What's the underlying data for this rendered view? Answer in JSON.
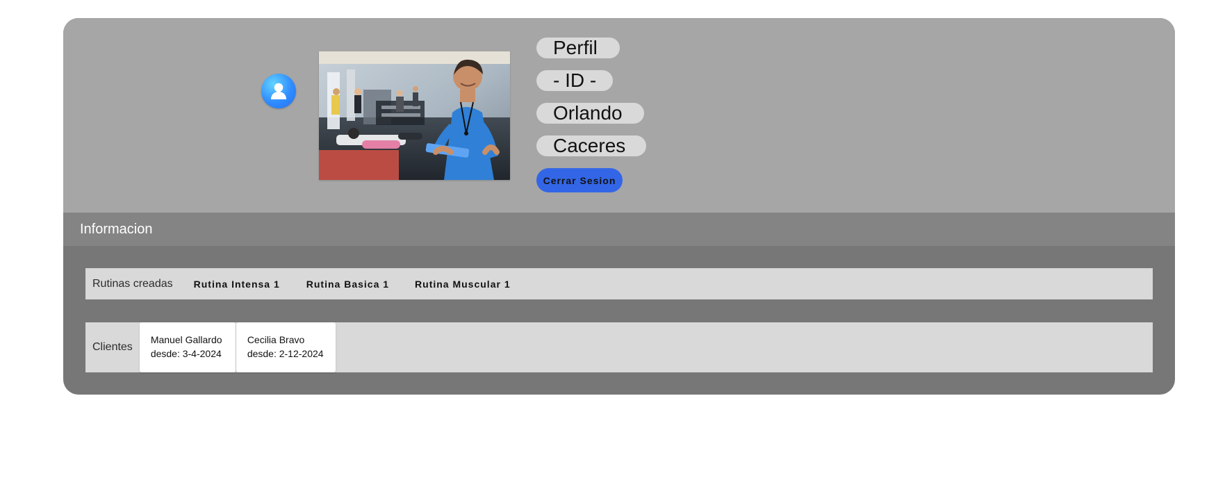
{
  "profile": {
    "title": "Perfil",
    "id_label": "- ID -",
    "first_name": "Orlando",
    "last_name": "Caceres",
    "logout_label": "Cerrar Sesion",
    "avatar_icon": "user-icon",
    "photo_description": "gym-trainer-photo"
  },
  "info": {
    "title": "Informacion",
    "routines": {
      "label": "Rutinas creadas",
      "items": [
        "Rutina Intensa 1",
        "Rutina Basica 1",
        "Rutina Muscular 1"
      ]
    },
    "clients": {
      "label": "Clientes",
      "items": [
        {
          "name": "Manuel Gallardo",
          "since": "desde: 3-4-2024"
        },
        {
          "name": "Cecilia Bravo",
          "since": "desde: 2-12-2024"
        }
      ]
    }
  },
  "colors": {
    "card_background": "#777777",
    "profile_background": "#a6a6a6",
    "header_background": "#848484",
    "pill_background": "#d9d9d9",
    "button_blue": "#3366e6",
    "row_background": "#d9d9d9"
  }
}
